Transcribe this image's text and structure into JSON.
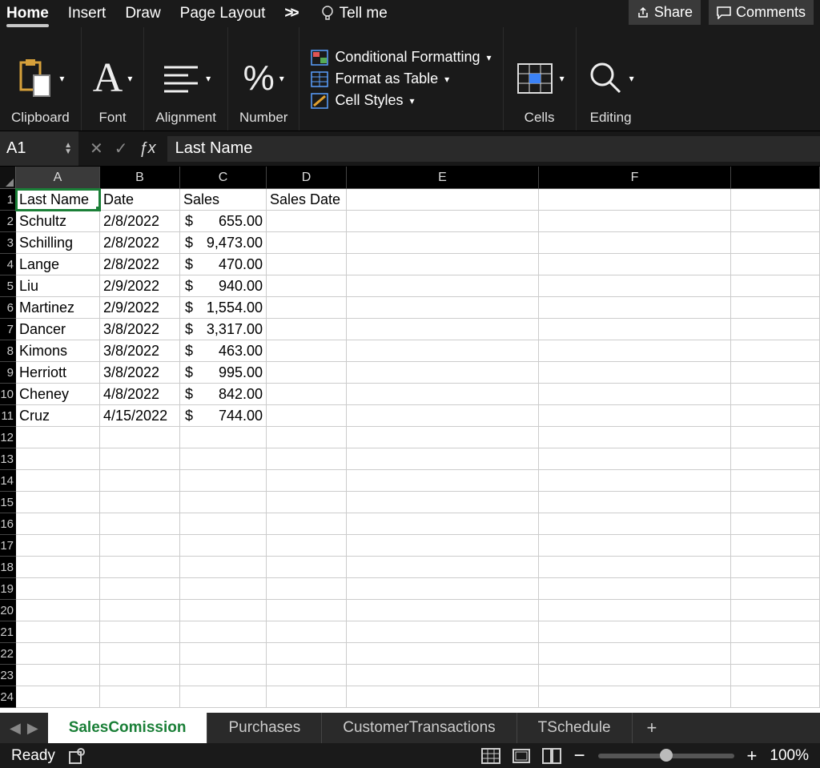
{
  "menu_tabs": {
    "items": [
      "Home",
      "Insert",
      "Draw",
      "Page Layout"
    ],
    "more": ">>",
    "tellme_icon": "bulb-icon",
    "tellme": "Tell me",
    "share": "Share",
    "comments": "Comments"
  },
  "ribbon": {
    "clipboard": "Clipboard",
    "font": "Font",
    "alignment": "Alignment",
    "number": "Number",
    "cond_fmt": "Conditional Formatting",
    "fmt_table": "Format as Table",
    "cell_styles": "Cell Styles",
    "cells": "Cells",
    "editing": "Editing"
  },
  "namebox": "A1",
  "formula": "Last Name",
  "columns": [
    "A",
    "B",
    "C",
    "D",
    "E",
    "F"
  ],
  "row_count": 24,
  "headers": {
    "A": "Last Name",
    "B": "Date",
    "C": "Sales",
    "D": "Sales Date"
  },
  "data": [
    {
      "last": "Schultz",
      "date": "2/8/2022",
      "sales": "655.00"
    },
    {
      "last": "Schilling",
      "date": "2/8/2022",
      "sales": "9,473.00"
    },
    {
      "last": "Lange",
      "date": "2/8/2022",
      "sales": "470.00"
    },
    {
      "last": "Liu",
      "date": "2/9/2022",
      "sales": "940.00"
    },
    {
      "last": "Martinez",
      "date": "2/9/2022",
      "sales": "1,554.00"
    },
    {
      "last": "Dancer",
      "date": "3/8/2022",
      "sales": "3,317.00"
    },
    {
      "last": "Kimons",
      "date": "3/8/2022",
      "sales": "463.00"
    },
    {
      "last": "Herriott",
      "date": "3/8/2022",
      "sales": "995.00"
    },
    {
      "last": "Cheney",
      "date": "4/8/2022",
      "sales": "842.00"
    },
    {
      "last": "Cruz",
      "date": "4/15/2022",
      "sales": "744.00"
    }
  ],
  "currency": "$",
  "sheet_tabs": {
    "active": "SalesComission",
    "others": [
      "Purchases",
      "CustomerTransactions",
      "TSchedule"
    ],
    "add": "+"
  },
  "status": {
    "ready": "Ready",
    "zoom": "100%",
    "minus": "−",
    "plus": "+"
  }
}
